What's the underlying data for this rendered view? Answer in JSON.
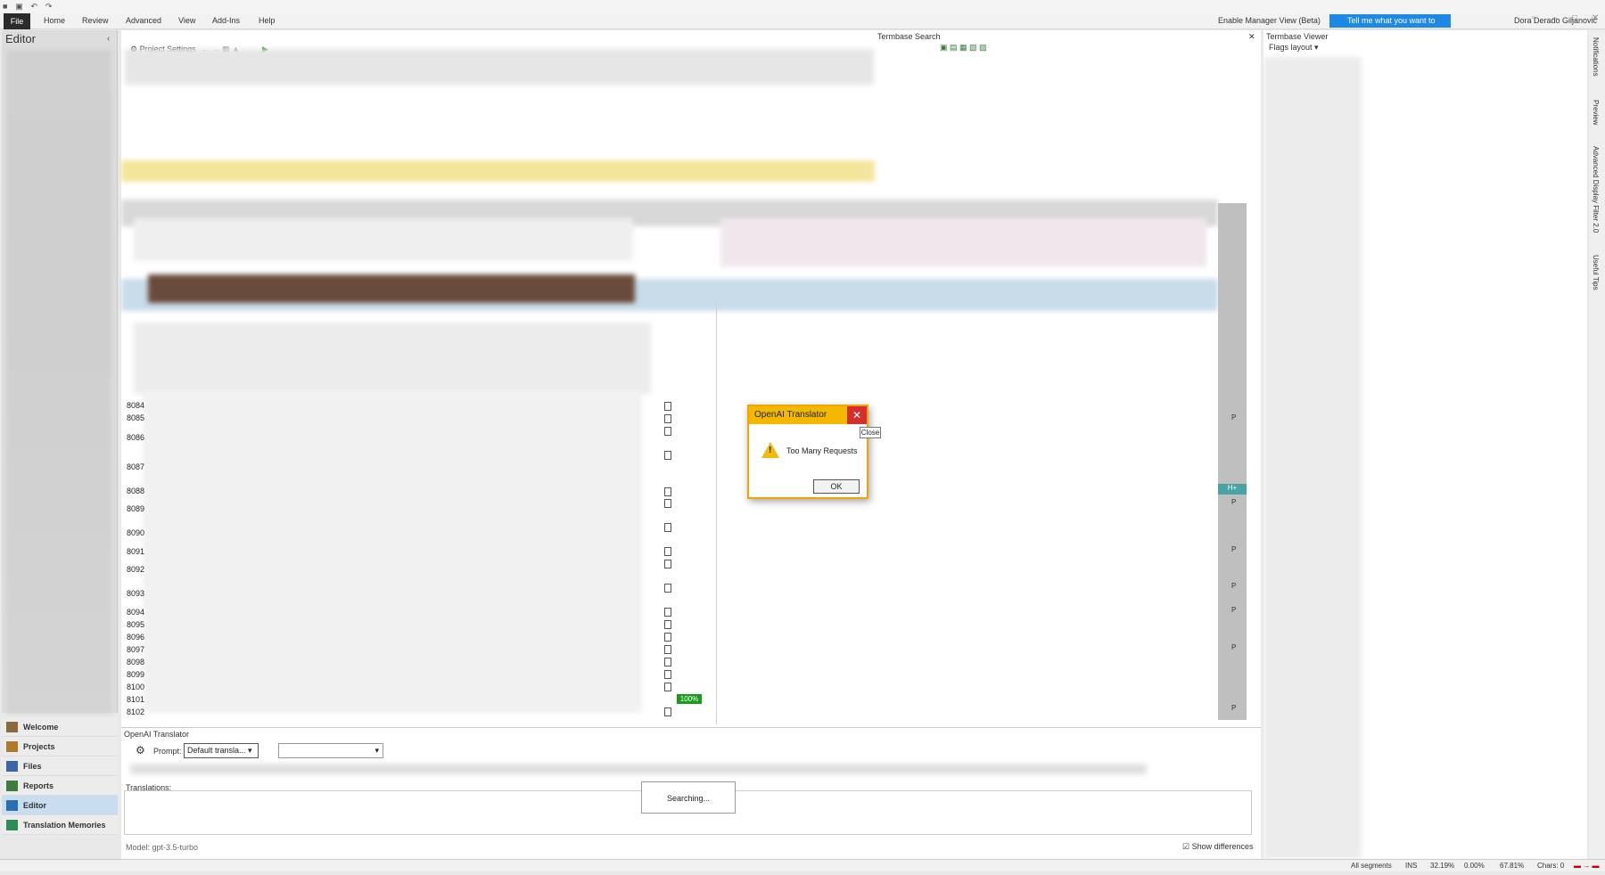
{
  "ribbon": {
    "file": "File",
    "tabs": [
      "Home",
      "Review",
      "Advanced",
      "View",
      "Add-Ins",
      "Help"
    ],
    "manager_view": "Enable Manager View (Beta)",
    "tell_me": "Tell me what you want to do...",
    "user": "Dora Derado Giljanović"
  },
  "left_pane": {
    "title": "Editor",
    "collapse_icon": "chevron-left-icon"
  },
  "nav": {
    "items": [
      {
        "label": "Welcome",
        "icon": "home-icon"
      },
      {
        "label": "Projects",
        "icon": "projects-icon"
      },
      {
        "label": "Files",
        "icon": "files-icon"
      },
      {
        "label": "Reports",
        "icon": "reports-icon"
      },
      {
        "label": "Editor",
        "icon": "pencil-icon",
        "selected": true
      },
      {
        "label": "Translation Memories",
        "icon": "tm-icon"
      }
    ]
  },
  "editor": {
    "project_settings": "Project Settings"
  },
  "termbase_search": {
    "title": "Termbase Search"
  },
  "termbase_viewer": {
    "title": "Termbase Viewer",
    "layout": "Flags layout"
  },
  "side_tabs": [
    "Notifications",
    "Preview",
    "Advanced Display Filter 2.0",
    "Useful Tips"
  ],
  "rows": [
    {
      "num": "8084",
      "flag": ""
    },
    {
      "num": "8085",
      "flag": "P"
    },
    {
      "num": "8086",
      "flag": ""
    },
    {
      "num": "8087",
      "flag": ""
    },
    {
      "num": "8088",
      "flag": "H+"
    },
    {
      "num": "8089",
      "flag": "P"
    },
    {
      "num": "8090",
      "flag": ""
    },
    {
      "num": "8091",
      "flag": "P"
    },
    {
      "num": "8092",
      "flag": ""
    },
    {
      "num": "8093",
      "flag": "P"
    },
    {
      "num": "8094",
      "flag": "P"
    },
    {
      "num": "8095",
      "flag": ""
    },
    {
      "num": "8096",
      "flag": ""
    },
    {
      "num": "8097",
      "flag": "P"
    },
    {
      "num": "8098",
      "flag": ""
    },
    {
      "num": "8099",
      "flag": ""
    },
    {
      "num": "8100",
      "flag": ""
    },
    {
      "num": "8101",
      "flag": ""
    },
    {
      "num": "8102",
      "flag": "P"
    }
  ],
  "match_badge": "100%",
  "openai_pane": {
    "title": "OpenAI Translator",
    "prompt_label": "Prompt:",
    "prompt_value": "Default transla...",
    "translations_label": "Translations:",
    "searching": "Searching...",
    "model": "Model: gpt-3.5-turbo",
    "show_differences": "Show differences"
  },
  "dialog": {
    "title": "OpenAI Translator",
    "message": "Too Many Requests",
    "ok": "OK",
    "tooltip": "Close"
  },
  "status": {
    "filter": "All segments",
    "mode": "INS",
    "s1": "32.19%",
    "s2": "0.00%",
    "s3": "67.81%",
    "chars": "Chars: 0"
  }
}
